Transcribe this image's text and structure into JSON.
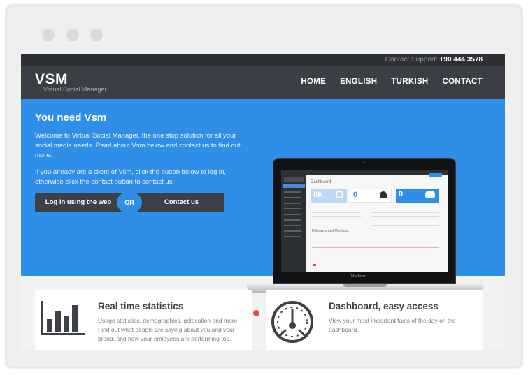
{
  "window": {
    "controls": [
      "close",
      "minimize",
      "maximize"
    ]
  },
  "topbar": {
    "support_label": "Contact Support:",
    "support_phone": "+90 444 3578"
  },
  "brand": {
    "logo": "VSM",
    "tagline": "Virtual Social Manager"
  },
  "nav": {
    "items": [
      "HOME",
      "ENGLISH",
      "TURKISH",
      "CONTACT"
    ]
  },
  "hero": {
    "title": "You need Vsm",
    "paragraph_1": "Welcome to Virtual Social Manager, the one stop solution for all your social media needs. Read about Vsm below and contact us to find out more.",
    "paragraph_2": "If you already are a client of Vsm, click the button below to log in, otherwise click the contact button to contact us.",
    "login_label": "Log in using the web",
    "or_label": "OR",
    "contact_label": "Contact us",
    "active_slide": 1,
    "slide_count": 2
  },
  "laptop_screen": {
    "page_title": "Dashboard",
    "tile_value_1": "0K",
    "tile_value_2": "0",
    "tile_value_3": "0",
    "section_label": "Followers and Mentions",
    "brand_label": "MacBook"
  },
  "features": [
    {
      "title": "Real time statistics",
      "text": "Usage statistics, demographics, golocation and more. Find out what people are saying about you and your brand, and how your emloyees are performing too.",
      "icon": "bar-chart-icon"
    },
    {
      "title": "Dashboard, easy access",
      "text": "View your most important facts of the day on the dashboard.",
      "icon": "speedometer-icon"
    }
  ],
  "colors": {
    "hero_blue": "#2f8ee8",
    "dark": "#3b3e44",
    "topbar": "#2d3035",
    "slider_active": "#e24b43"
  }
}
